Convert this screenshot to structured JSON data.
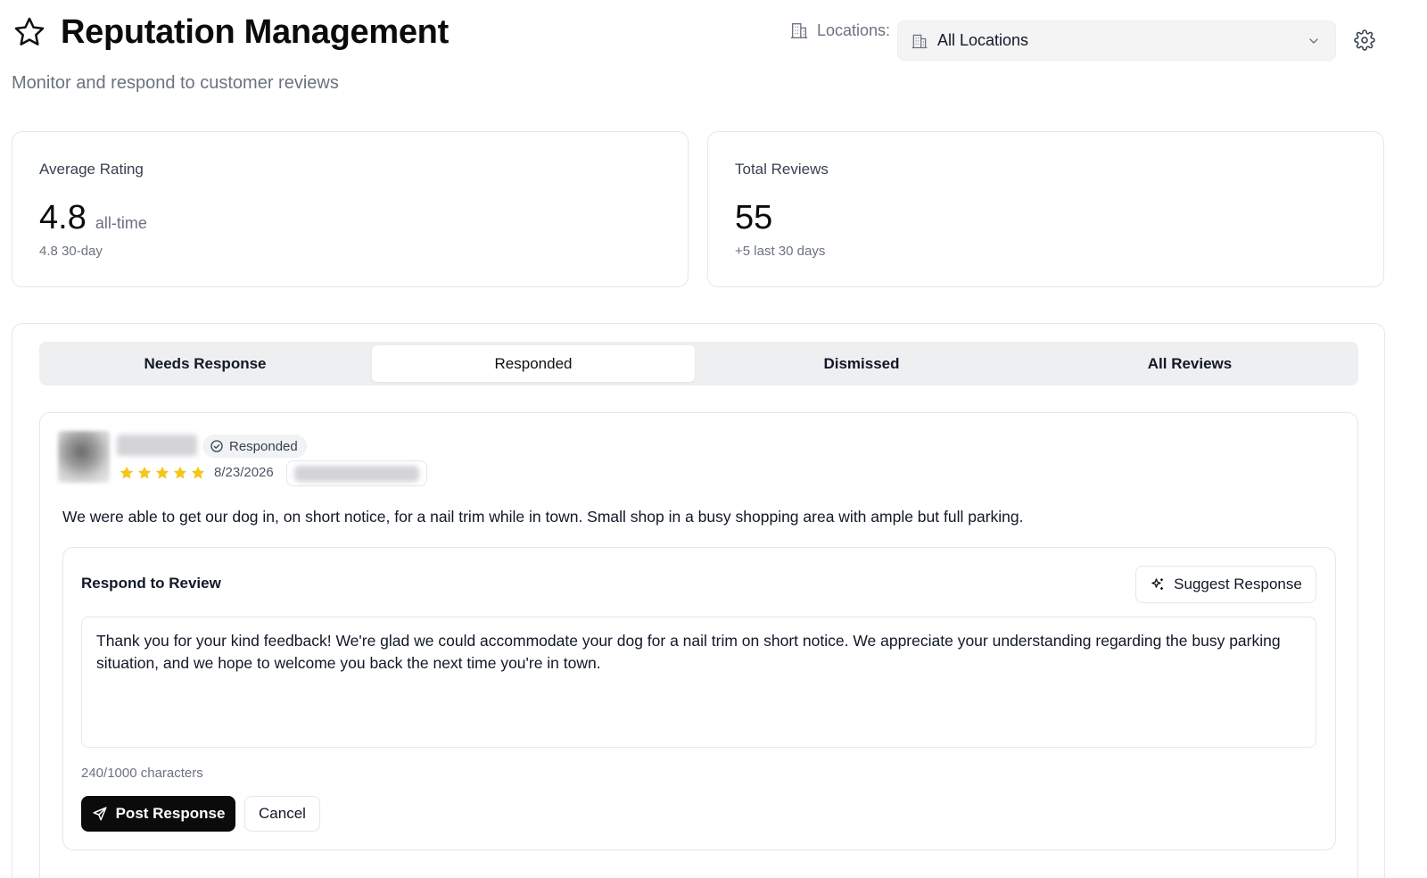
{
  "header": {
    "title": "Reputation Management",
    "subtitle": "Monitor and respond to customer reviews",
    "title_icon": "star-icon",
    "locations_label": "Locations:",
    "location_select_value": "All Locations",
    "settings_icon": "gear-icon"
  },
  "stats": {
    "average_rating": {
      "label": "Average Rating",
      "value": "4.8",
      "suffix": "all-time",
      "sub": "4.8 30-day"
    },
    "total_reviews": {
      "label": "Total Reviews",
      "value": "55",
      "sub": "+5 last 30 days"
    }
  },
  "tabs": [
    {
      "label": "Needs Response",
      "active": false
    },
    {
      "label": "Responded",
      "active": true
    },
    {
      "label": "Dismissed",
      "active": false
    },
    {
      "label": "All Reviews",
      "active": false
    }
  ],
  "review": {
    "status": "Responded",
    "rating": 5,
    "date": "8/23/2026",
    "text": "We were able to get our dog in, on short notice, for a nail trim while in town. Small shop in a busy shopping area with ample but full parking."
  },
  "respond": {
    "title": "Respond to Review",
    "suggest_label": "Suggest Response",
    "response_text": "Thank you for your kind feedback! We're glad we could accommodate your dog for a nail trim on short notice. We appreciate your understanding regarding the busy parking situation, and we hope to welcome you back the next time you're in town.",
    "char_count": "240/1000 characters",
    "post_label": "Post Response",
    "cancel_label": "Cancel"
  },
  "colors": {
    "star": "#f5c518",
    "primary_button": "#0b0b0b",
    "tab_bar": "#eeeff1",
    "border": "#e5e7eb"
  }
}
